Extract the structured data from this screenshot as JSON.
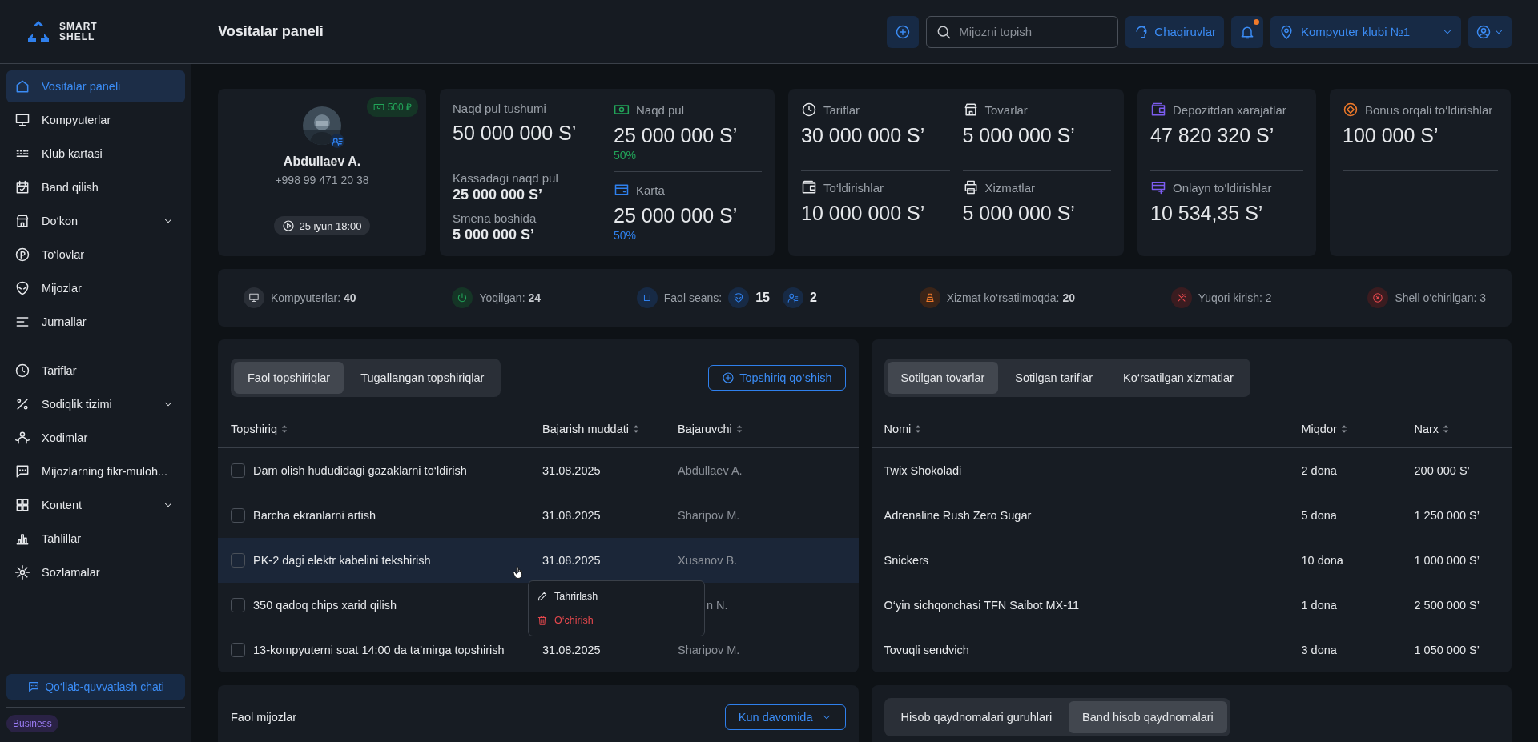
{
  "brand": {
    "line_1": "SMART",
    "line_2": "SHELL"
  },
  "header": {
    "title": "Vositalar paneli",
    "search": {
      "placeholder": "Mijozni topish"
    },
    "calls_button": "Chaqiruvlar",
    "notifications": {
      "unread": true
    },
    "club": "Kompyuter klubi №1"
  },
  "sidebar": {
    "groups": [
      [
        {
          "label": "Vositalar paneli",
          "selected": true,
          "expandable": false
        },
        {
          "label": "Kompyuterlar",
          "selected": false,
          "expandable": false
        },
        {
          "label": "Klub kartasi",
          "selected": false,
          "expandable": false
        },
        {
          "label": "Band qilish",
          "selected": false,
          "expandable": false
        },
        {
          "label": "Do‘kon",
          "selected": false,
          "expandable": true
        },
        {
          "label": "To‘lovlar",
          "selected": false,
          "expandable": false
        },
        {
          "label": "Mijozlar",
          "selected": false,
          "expandable": false
        },
        {
          "label": "Jurnallar",
          "selected": false,
          "expandable": false
        }
      ],
      [
        {
          "label": "Tariflar",
          "selected": false,
          "expandable": false
        },
        {
          "label": "Sodiqlik tizimi",
          "selected": false,
          "expandable": true
        },
        {
          "label": "Xodimlar",
          "selected": false,
          "expandable": false
        },
        {
          "label": "Mijozlarning fikr-muloh...",
          "selected": false,
          "expandable": false
        },
        {
          "label": "Kontent",
          "selected": false,
          "expandable": true
        },
        {
          "label": "Tahlillar",
          "selected": false,
          "expandable": false
        },
        {
          "label": "Sozlamalar",
          "selected": false,
          "expandable": false
        }
      ]
    ],
    "support_button": "Qo‘llab-quvvatlash chati",
    "plan_badge": "Business"
  },
  "profile": {
    "bonus": "500 ₽",
    "name": "Abdullaev A.",
    "phone": "+998 99 471 20 38",
    "session_start": "25 iyun 18:00"
  },
  "cash_card": {
    "income": {
      "label": "Naqd pul tushumi",
      "value": "50 000 000 S’"
    },
    "register": {
      "label": "Kassadagi naqd pul",
      "value": "25 000 000 S’"
    },
    "shift_start": {
      "label": "Smena boshida",
      "value": "5 000 000 S’"
    },
    "methods": [
      {
        "label": "Naqd pul",
        "value": "25 000 000 S’",
        "share": "50%",
        "color": "#22a559"
      },
      {
        "label": "Karta",
        "value": "25 000 000 S’",
        "share": "50%",
        "color": "#2f80ed"
      }
    ]
  },
  "metric_cards": [
    {
      "top": [
        {
          "label": "Tariflar",
          "value": "30 000 000 S’"
        },
        {
          "label": "Tovarlar",
          "value": "5 000 000 S’"
        }
      ],
      "bottom": [
        {
          "label": "To‘ldirishlar",
          "value": "10 000 000 S’"
        },
        {
          "label": "Xizmatlar",
          "value": "5 000 000 S’"
        }
      ]
    },
    {
      "top": [
        {
          "label": "Depozitdan xarajatlar",
          "value": "47 820 320 S’"
        }
      ],
      "bottom": [
        {
          "label": "Onlayn to‘ldirishlar",
          "value": "10 534,35 S’"
        }
      ]
    },
    {
      "top": [
        {
          "label": "Bonus orqali to‘ldirishlar",
          "value": "100 000 S’"
        }
      ]
    }
  ],
  "status_bar": {
    "items": [
      {
        "kind": "stat",
        "text": "Kompyuterlar: **40**"
      },
      {
        "kind": "stat",
        "text": "Yoqilgan: **24**"
      },
      {
        "kind": "sessions",
        "label": "Faol seans:",
        "counts": [
          "15",
          "2"
        ]
      },
      {
        "kind": "stat",
        "text": "Xizmat ko‘rsatilmoqda: **20**"
      },
      {
        "kind": "stat",
        "text": "Yuqori kirish: 2"
      },
      {
        "kind": "stat",
        "text": "Shell o‘chirilgan: 3"
      }
    ]
  },
  "tasks": {
    "tabs": [
      {
        "label": "Faol topshiriqlar",
        "selected": true
      },
      {
        "label": "Tugallangan topshiriqlar",
        "selected": false
      }
    ],
    "add_button": "Topshiriq qo‘shish",
    "columns": [
      "Topshiriq",
      "Bajarish muddati",
      "Bajaruvchi"
    ],
    "rows": [
      {
        "task": "Dam olish hududidagi gazaklarni to‘ldirish",
        "due": "31.08.2025",
        "assignee": "Abdullaev A.",
        "checked": false,
        "hovered": false
      },
      {
        "task": "Barcha ekranlarni artish",
        "due": "31.08.2025",
        "assignee": "Sharipov M.",
        "checked": false,
        "hovered": false
      },
      {
        "task": "PK-2 dagi elektr kabelini tekshirish",
        "due": "31.08.2025",
        "assignee": "Xusanov B.",
        "checked": false,
        "hovered": true
      },
      {
        "task": "350 qadoq chips xarid qilish",
        "assignee": "n N.",
        "checked": false,
        "hovered": false
      },
      {
        "task": "13-kompyuterni soat 14:00 da ta’mirga topshirish",
        "due": "31.08.2025",
        "assignee": "Sharipov M.",
        "checked": false,
        "hovered": false
      }
    ],
    "context_menu": [
      {
        "kind": "edit",
        "label": "Tahrirlash"
      },
      {
        "kind": "delete",
        "label": "O‘chirish"
      }
    ]
  },
  "sales": {
    "tabs": [
      {
        "label": "Sotilgan tovarlar",
        "selected": true
      },
      {
        "label": "Sotilgan tariflar",
        "selected": false
      },
      {
        "label": "Ko‘rsatilgan xizmatlar",
        "selected": false
      }
    ],
    "columns": [
      "Nomi",
      "Miqdor",
      "Narx"
    ],
    "rows": [
      {
        "name": "Twix Shokoladi",
        "quantity": "2 dona",
        "price": "200 000 S’"
      },
      {
        "name": "Adrenaline Rush Zero Sugar",
        "quantity": "5 dona",
        "price": "1 250 000 S’"
      },
      {
        "name": "Snickers",
        "quantity": "10 dona",
        "price": "1 000 000 S’"
      },
      {
        "name": "O‘yin sichqonchasi TFN Saibot MX-11",
        "quantity": "1 dona",
        "price": "2 500 000 S’"
      },
      {
        "name": "Tovuqli sendvich",
        "quantity": "3 dona",
        "price": "1 050 000 S’"
      }
    ]
  },
  "active_clients": {
    "title": "Faol mijozlar",
    "period": "Kun davomida"
  },
  "invoices": {
    "tabs": [
      {
        "label": "Hisob qaydnomalari guruhlari",
        "selected": false
      },
      {
        "label": "Band hisob qaydnomalari",
        "selected": true
      }
    ]
  }
}
